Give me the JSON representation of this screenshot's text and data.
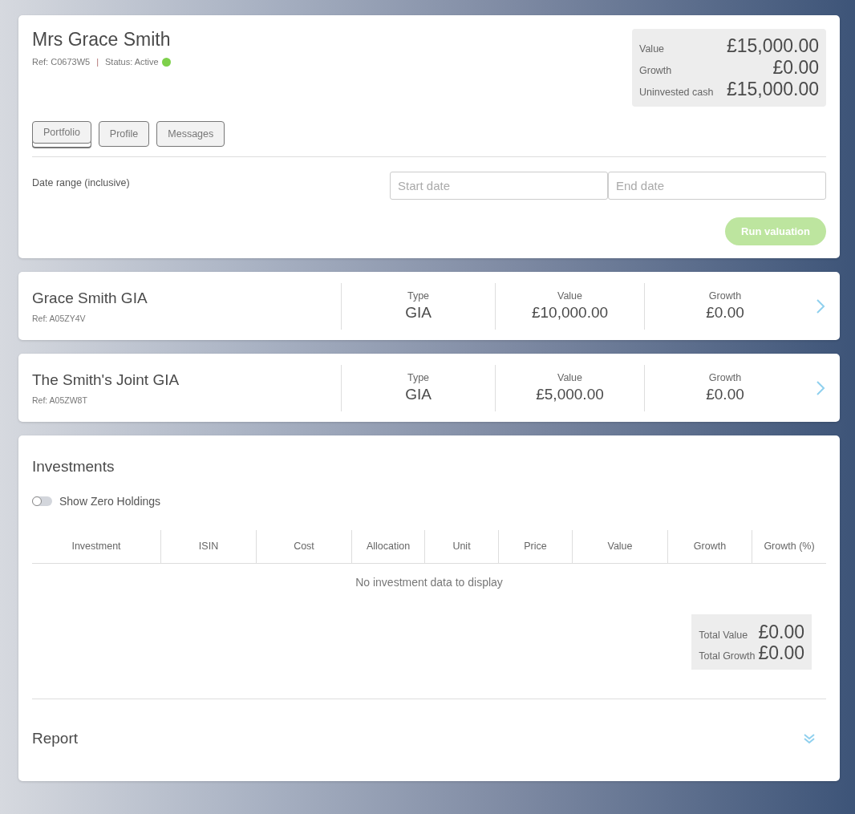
{
  "client": {
    "name": "Mrs Grace Smith",
    "ref": "Ref:  C0673W5",
    "separator": "|",
    "status": "Status: Active",
    "active": true
  },
  "summary": [
    {
      "label": "Value",
      "amount": "£15,000.00"
    },
    {
      "label": "Growth",
      "amount": "£0.00"
    },
    {
      "label": "Uninvested cash",
      "amount": "£15,000.00"
    }
  ],
  "tabs": [
    {
      "label": "Portfolio",
      "selected": true
    },
    {
      "label": "Profile",
      "selected": false
    },
    {
      "label": "Messages",
      "selected": false
    }
  ],
  "date_range": {
    "label": "Date range (inclusive)",
    "start_placeholder": "Start date",
    "end_placeholder": "End date"
  },
  "run_button": {
    "label": "Run valuation",
    "disabled": true
  },
  "accounts": [
    {
      "name": "Grace Smith GIA",
      "ref": "Ref: A05ZY4V",
      "type_label": "Type",
      "type": "GIA",
      "value_label": "Value",
      "value": "£10,000.00",
      "growth_label": "Growth",
      "growth": "£0.00"
    },
    {
      "name": "The Smith's Joint GIA",
      "ref": "Ref: A05ZW8T",
      "type_label": "Type",
      "type": "GIA",
      "value_label": "Value",
      "value": "£5,000.00",
      "growth_label": "Growth",
      "growth": "£0.00"
    }
  ],
  "investments": {
    "title": "Investments",
    "toggle": {
      "label": "Show Zero Holdings",
      "on": false
    },
    "columns": [
      "Investment",
      "ISIN",
      "Cost",
      "Allocation",
      "Unit",
      "Price",
      "Value",
      "Growth",
      "Growth (%)"
    ],
    "empty_message": "No investment data to display",
    "totals": [
      {
        "label": "Total Value",
        "amount": "£0.00"
      },
      {
        "label": "Total Growth",
        "amount": "£0.00"
      }
    ]
  },
  "report": {
    "title": "Report",
    "expanded": false
  }
}
